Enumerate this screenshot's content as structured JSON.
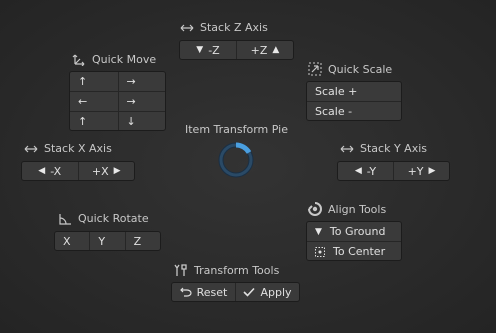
{
  "pie": {
    "title": "Item Transform Pie"
  },
  "stack_z": {
    "title": "Stack Z Axis",
    "neg": "-Z",
    "pos": "+Z"
  },
  "quick_move": {
    "title": "Quick Move",
    "arrows": [
      "↑",
      "→",
      "←",
      "→",
      "↑",
      "↓"
    ]
  },
  "quick_scale": {
    "title": "Quick Scale",
    "items": [
      "Scale +",
      "Scale -"
    ]
  },
  "stack_x": {
    "title": "Stack X Axis",
    "neg": "-X",
    "pos": "+X"
  },
  "stack_y": {
    "title": "Stack Y Axis",
    "neg": "-Y",
    "pos": "+Y"
  },
  "quick_rotate": {
    "title": "Quick Rotate",
    "x": "X",
    "y": "Y",
    "z": "Z"
  },
  "align_tools": {
    "title": "Align Tools",
    "to_ground": "To Ground",
    "to_center": "To Center"
  },
  "transform_tools": {
    "title": "Transform Tools",
    "reset": "Reset",
    "apply": "Apply"
  },
  "colors": {
    "accent": "#4a9fe0",
    "background": "#2b2b2b",
    "button": "#3a3a3a"
  }
}
